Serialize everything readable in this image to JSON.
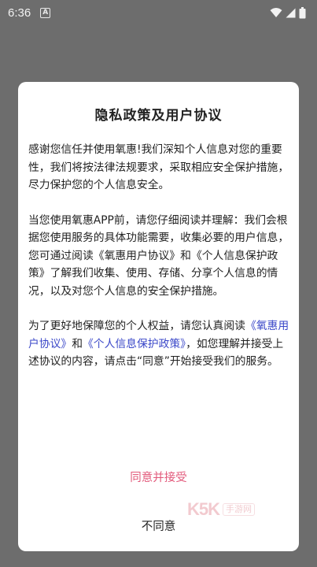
{
  "status_bar": {
    "time": "6:36",
    "notification_icon_letter": "A",
    "icons": [
      "wifi-icon",
      "signal-icon",
      "battery-icon"
    ]
  },
  "dialog": {
    "title": "隐私政策及用户协议",
    "para1": "感谢您信任并使用氧惠!我们深知个人信息对您的重要性，我们将按法律法规要求，采取相应安全保护措施，尽力保护您的个人信息安全。",
    "para2": "当您使用氧惠APP前，请您仔细阅读并理解：我们会根据您使用服务的具体功能需要，收集必要的用户信息，您可通过阅读《氧惠用户协议》和《个人信息保护政策》了解我们收集、使用、存储、分享个人信息的情况，以及对您个人信息的安全保护措施。",
    "para3_prefix": "为了更好地保障您的个人权益，请您认真阅读",
    "para3_link1": "《氧惠用户协议》",
    "para3_and": "和",
    "para3_link2": "《个人信息保护政策》",
    "para3_suffix": "，如您理解并接受上述协议的内容，请点击“同意”开始接受我们的服务。",
    "agree_label": "同意并接受",
    "disagree_label": "不同意"
  },
  "watermark": {
    "mark": "K5K",
    "text": "手游网"
  },
  "colors": {
    "link": "#3a47c8",
    "agree": "#e2587a",
    "overlay": "#6d6d6d"
  }
}
